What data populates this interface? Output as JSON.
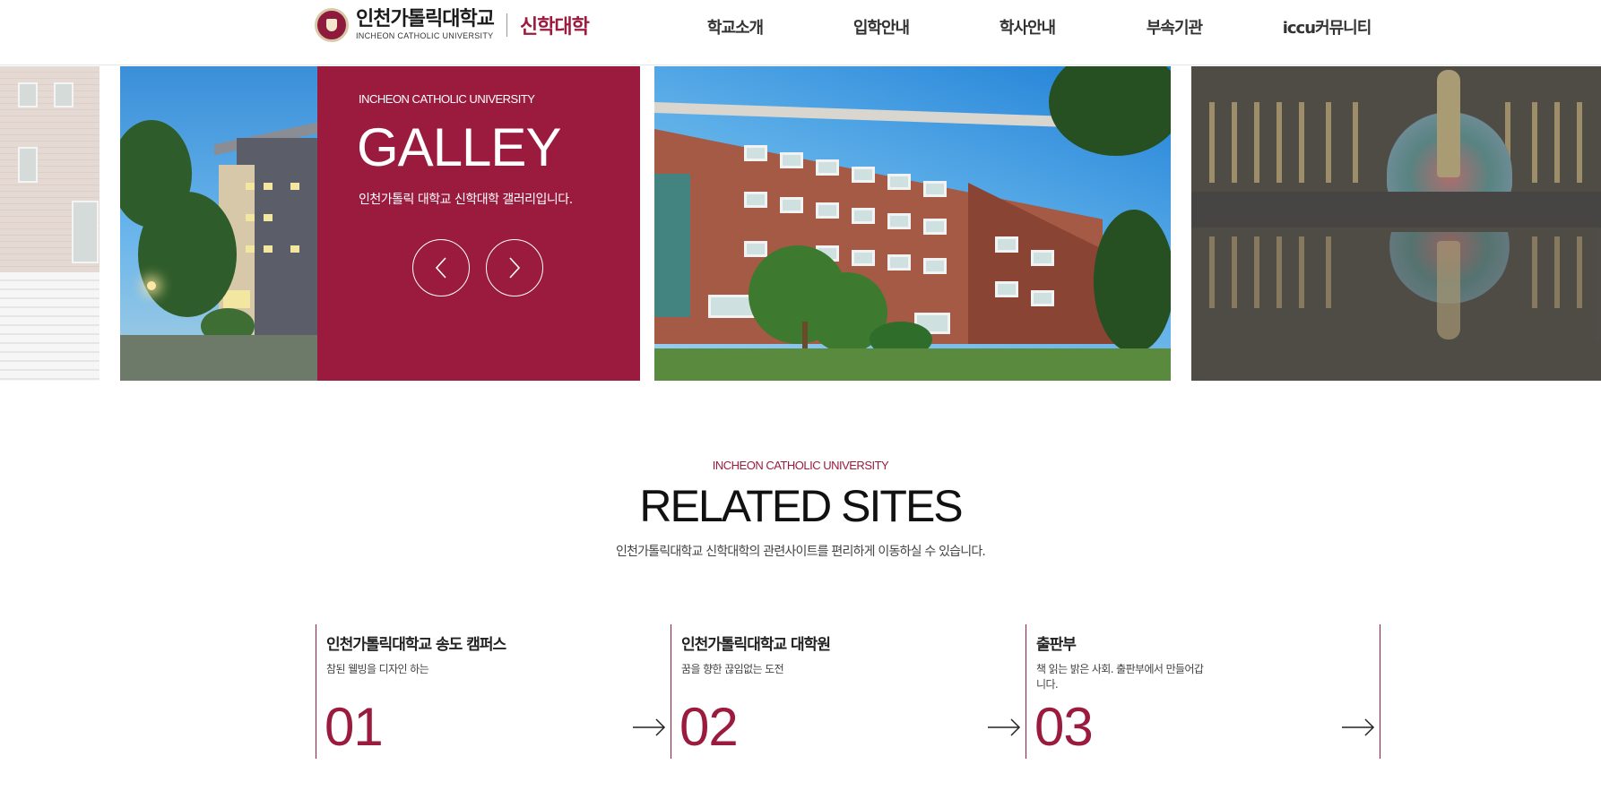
{
  "header": {
    "logo_korean": "인천가톨릭대학교",
    "logo_english": "INCHEON CATHOLIC UNIVERSITY",
    "department": "신학대학",
    "nav": [
      {
        "label": "학교소개"
      },
      {
        "label": "입학안내"
      },
      {
        "label": "학사안내"
      },
      {
        "label": "부속기관"
      },
      {
        "label": "iccu커뮤니티"
      }
    ]
  },
  "gallery": {
    "kicker": "INCHEON CATHOLIC UNIVERSITY",
    "title": "GALLEY",
    "description": "인천가톨릭 대학교 신학대학 갤러리입니다.",
    "prev_icon": "chevron-left-icon",
    "next_icon": "chevron-right-icon"
  },
  "related": {
    "kicker": "INCHEON CATHOLIC UNIVERSITY",
    "title": "RELATED SITES",
    "description": "인천가톨릭대학교 신학대학의 관련사이트를 편리하게 이동하실 수 있습니다.",
    "sites": [
      {
        "title": "인천가톨릭대학교 송도 캠퍼스",
        "subtitle": "참된 웰빙을 디자인 하는",
        "number": "01"
      },
      {
        "title": "인천가톨릭대학교 대학원",
        "subtitle": "꿈을 향한 끊임없는 도전",
        "number": "02"
      },
      {
        "title": "출판부",
        "subtitle": "책 읽는 밝은 사회. 출판부에서 만들어갑니다.",
        "number": "03"
      }
    ]
  },
  "colors": {
    "accent": "#9b1b3f",
    "text": "#222222"
  }
}
